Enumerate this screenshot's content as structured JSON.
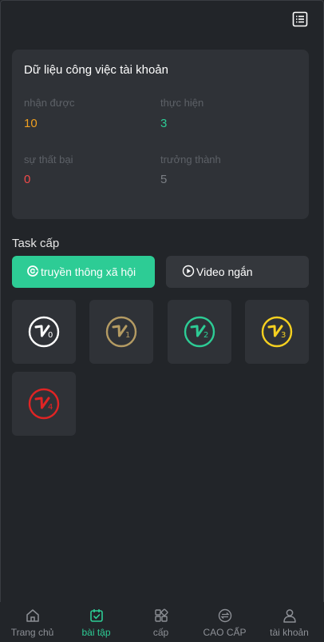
{
  "header": {
    "menu_icon": "list-icon"
  },
  "account_card": {
    "title": "Dữ liệu công việc tài khoản",
    "stats": [
      {
        "label": "nhận được",
        "value": "10",
        "color": "#f0a020"
      },
      {
        "label": "thực hiện",
        "value": "3",
        "color": "#2dcc95"
      },
      {
        "label": "sự thất bại",
        "value": "0",
        "color": "#f04a4a"
      },
      {
        "label": "trưởng thành",
        "value": "5",
        "color": "#7b7f85"
      }
    ]
  },
  "task_section": {
    "title": "Task cấp",
    "tabs": [
      {
        "label": "truyền thông xã hội",
        "icon": "social-icon",
        "active": true
      },
      {
        "label": "Video ngắn",
        "icon": "play-icon",
        "active": false
      }
    ],
    "levels": [
      {
        "level": "0",
        "color": "#ffffff"
      },
      {
        "level": "1",
        "color": "#b49b63"
      },
      {
        "level": "2",
        "color": "#2dcc95"
      },
      {
        "level": "3",
        "color": "#f5d020"
      },
      {
        "level": "4",
        "color": "#e02424"
      }
    ]
  },
  "bottom_nav": {
    "items": [
      {
        "label": "Trang chủ",
        "icon": "home-icon",
        "active": false
      },
      {
        "label": "bài tập",
        "icon": "task-icon",
        "active": true
      },
      {
        "label": "cấp",
        "icon": "grid-icon",
        "active": false
      },
      {
        "label": "CAO CẤP",
        "icon": "exchange-icon",
        "active": false
      },
      {
        "label": "tài khoản",
        "icon": "user-icon",
        "active": false
      }
    ]
  },
  "colors": {
    "accent": "#2dcc95",
    "background": "#222529",
    "card": "#2f3237"
  }
}
